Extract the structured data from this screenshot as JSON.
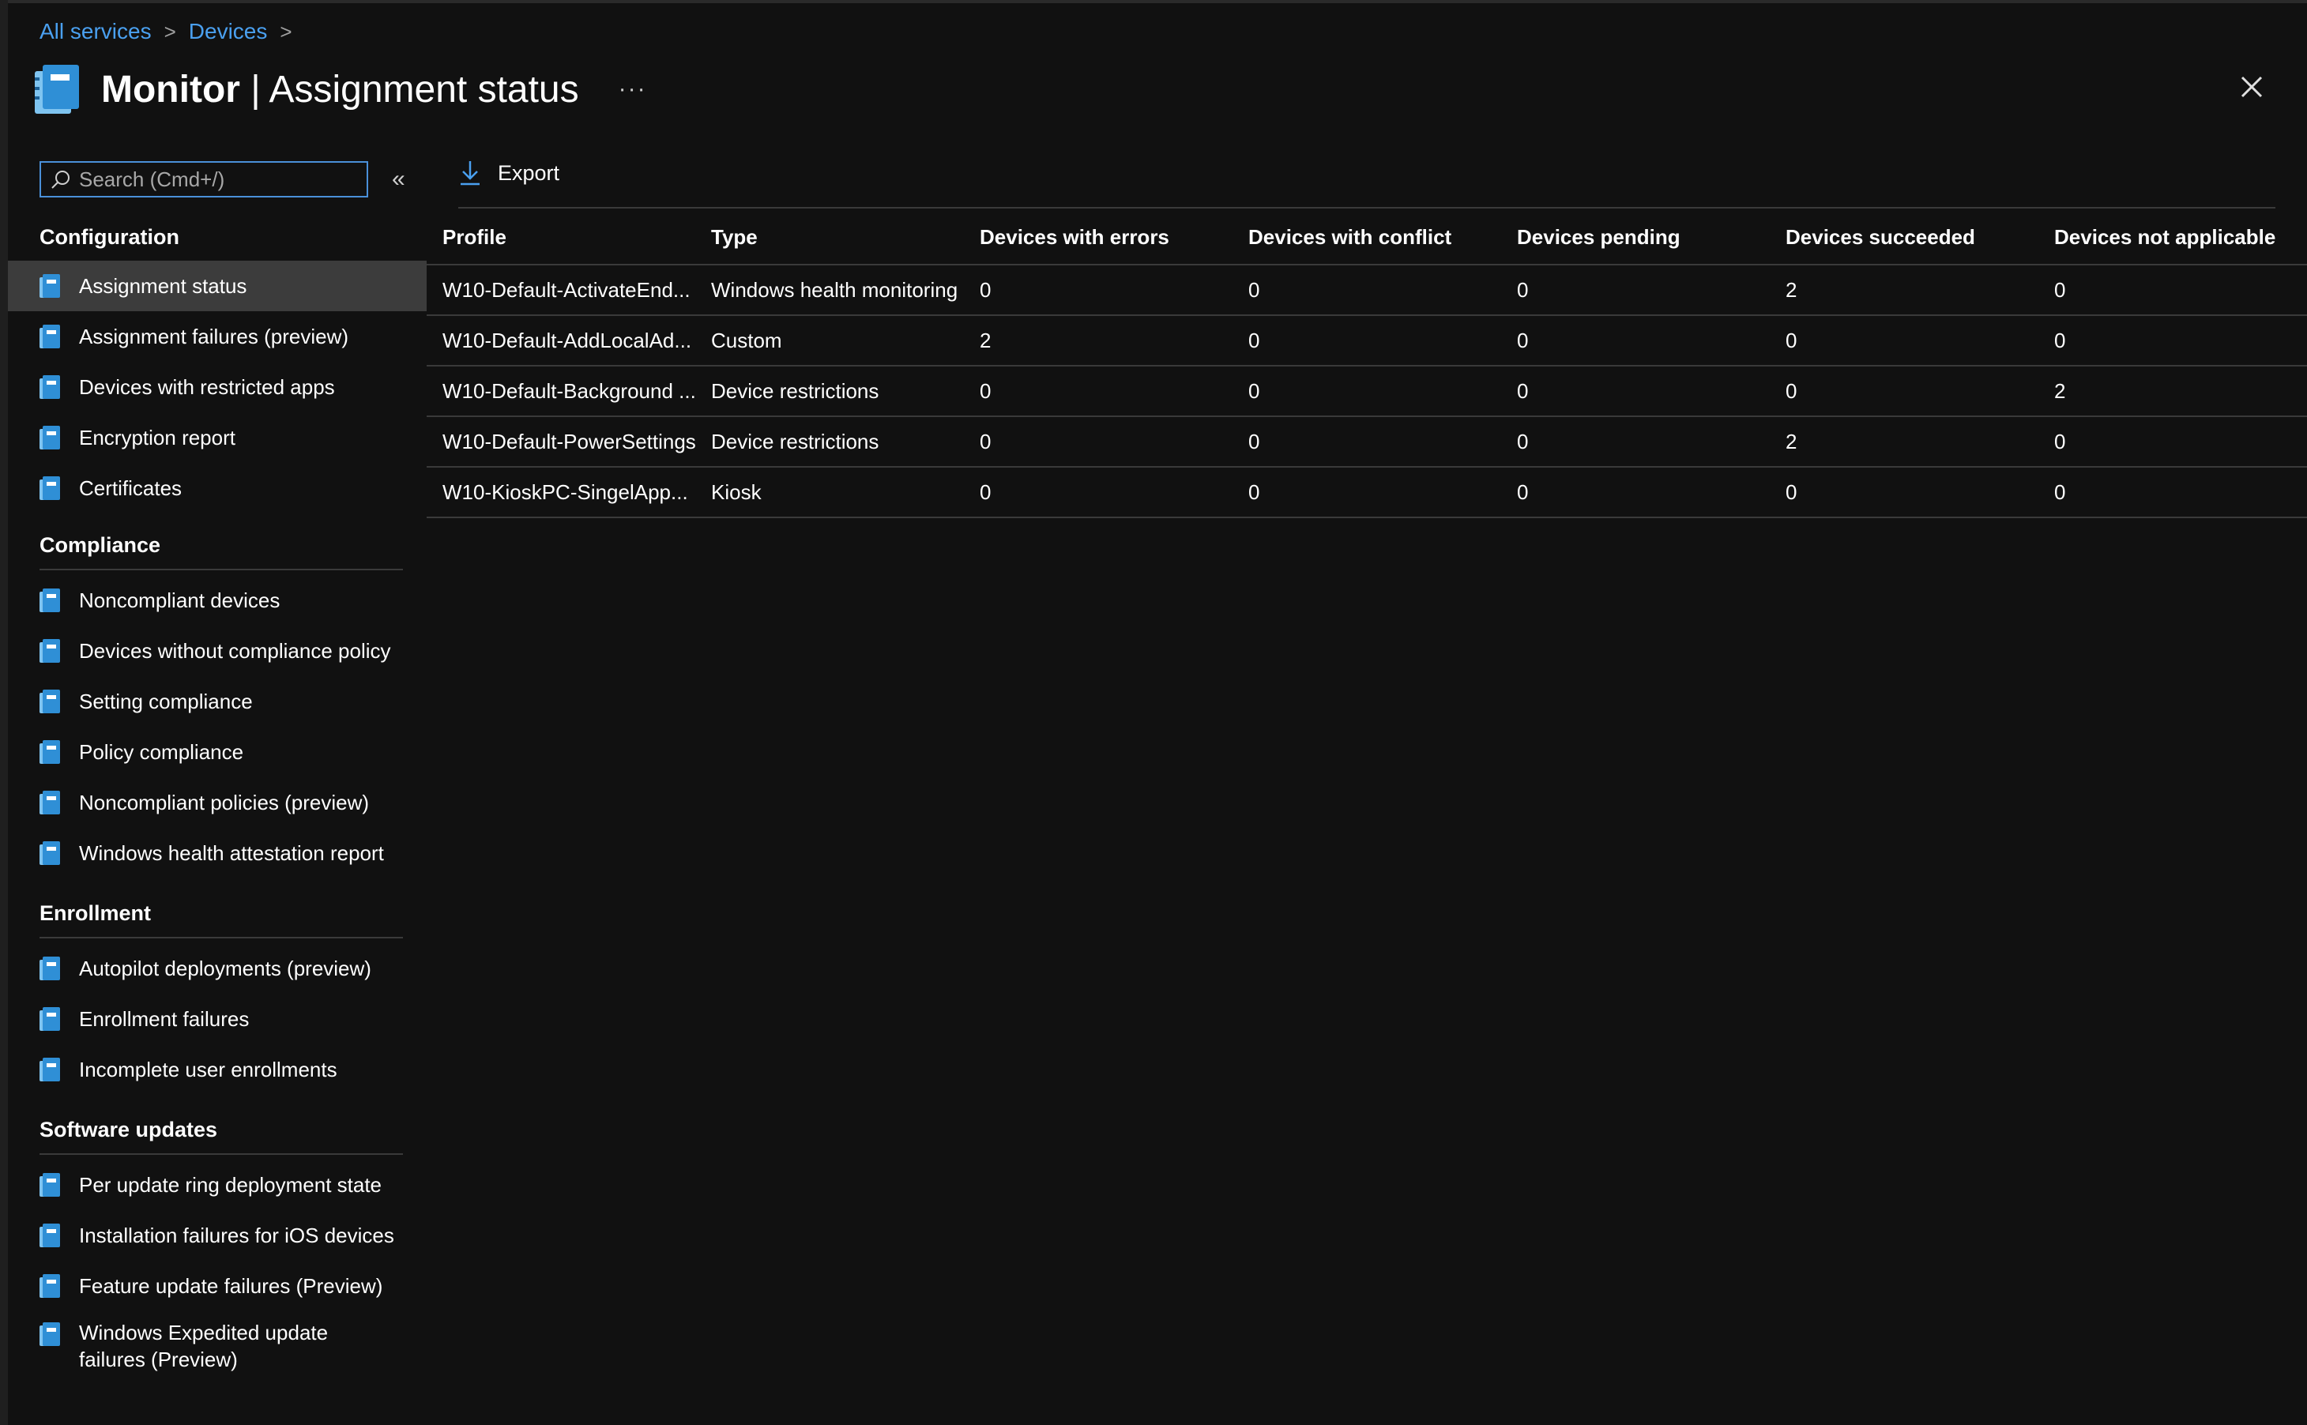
{
  "breadcrumb": [
    {
      "label": "All services"
    },
    {
      "label": "Devices"
    }
  ],
  "breadcrumb_sep": ">",
  "header": {
    "title_bold": "Monitor",
    "title_rest": " | Assignment status",
    "more": "···"
  },
  "search": {
    "placeholder": "Search (Cmd+/)",
    "value": ""
  },
  "collapse": "«",
  "sidebar": {
    "sections": [
      {
        "title": "Configuration",
        "items": [
          {
            "label": "Assignment status",
            "active": true
          },
          {
            "label": "Assignment failures (preview)"
          },
          {
            "label": "Devices with restricted apps"
          },
          {
            "label": "Encryption report"
          },
          {
            "label": "Certificates"
          }
        ]
      },
      {
        "title": "Compliance",
        "items": [
          {
            "label": "Noncompliant devices"
          },
          {
            "label": "Devices without compliance policy"
          },
          {
            "label": "Setting compliance"
          },
          {
            "label": "Policy compliance"
          },
          {
            "label": "Noncompliant policies (preview)"
          },
          {
            "label": "Windows health attestation report"
          }
        ]
      },
      {
        "title": "Enrollment",
        "items": [
          {
            "label": "Autopilot deployments (preview)"
          },
          {
            "label": "Enrollment failures"
          },
          {
            "label": "Incomplete user enrollments"
          }
        ]
      },
      {
        "title": "Software updates",
        "items": [
          {
            "label": "Per update ring deployment state"
          },
          {
            "label": "Installation failures for iOS devices"
          },
          {
            "label": "Feature update failures (Preview)"
          },
          {
            "label": "Windows Expedited update failures (Preview)",
            "multiline": true
          }
        ]
      }
    ]
  },
  "toolbar": {
    "export_label": "Export"
  },
  "table": {
    "columns": [
      "Profile",
      "Type",
      "Devices with errors",
      "Devices with conflict",
      "Devices pending",
      "Devices succeeded",
      "Devices not applicable"
    ],
    "rows": [
      [
        "W10-Default-ActivateEnd...",
        "Windows health monitoring",
        "0",
        "0",
        "0",
        "2",
        "0"
      ],
      [
        "W10-Default-AddLocalAd...",
        "Custom",
        "2",
        "0",
        "0",
        "0",
        "0"
      ],
      [
        "W10-Default-Background ...",
        "Device restrictions",
        "0",
        "0",
        "0",
        "0",
        "2"
      ],
      [
        "W10-Default-PowerSettings",
        "Device restrictions",
        "0",
        "0",
        "0",
        "2",
        "0"
      ],
      [
        "W10-KioskPC-SingelApp...",
        "Kiosk",
        "0",
        "0",
        "0",
        "0",
        "0"
      ]
    ]
  },
  "colors": {
    "accent": "#4aa0f0",
    "background": "#111111",
    "active_item": "#3c3c3c",
    "icon_blue": "#2f8fd6"
  }
}
